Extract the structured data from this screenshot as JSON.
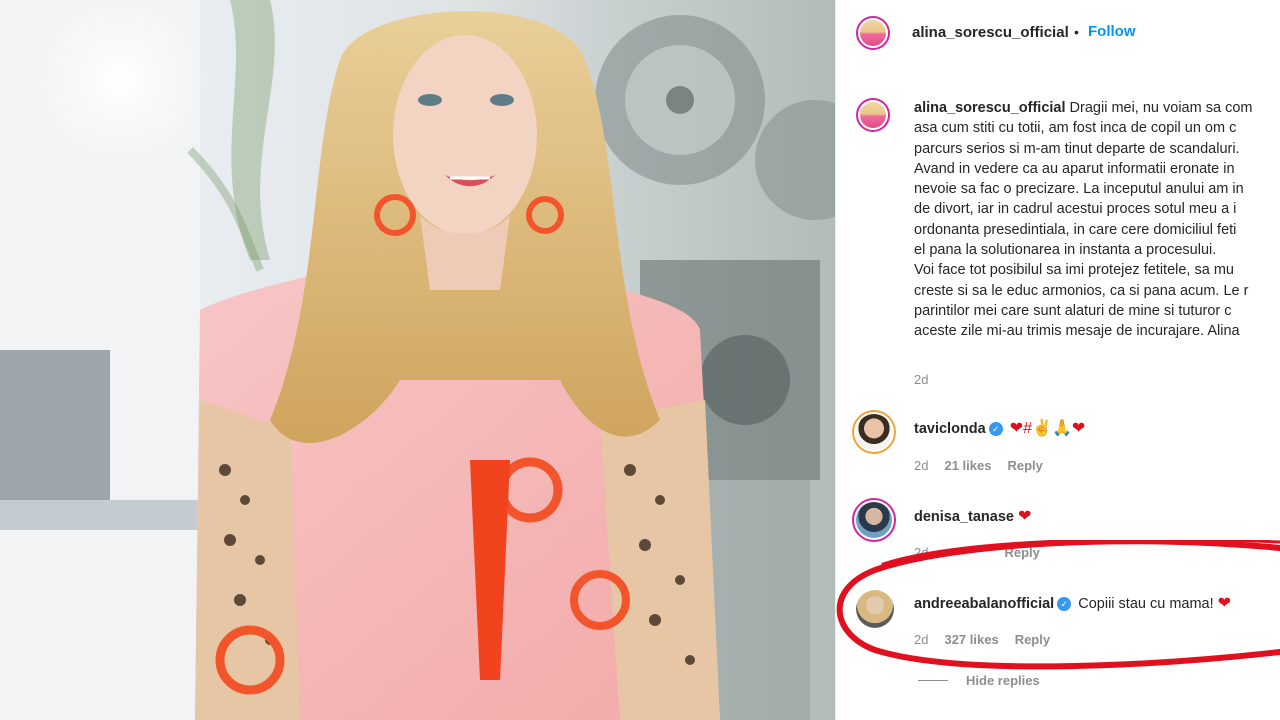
{
  "post": {
    "username": "alina_sorescu_official",
    "separator": "•",
    "follow_label": "Follow",
    "caption_lines": [
      "Dragii mei, nu voiam sa com",
      "asa cum stiti cu totii, am fost inca de copil un om c",
      "parcurs serios si m-am tinut departe de scandaluri.",
      "Avand in vedere ca au aparut informatii eronate in",
      "nevoie sa fac o precizare. La inceputul anului am in",
      "de divort, iar in cadrul acestui proces sotul meu a i",
      "ordonanta presedintiala, in care cere domiciliul feti",
      "el pana la solutionarea in instanta a procesului.",
      "Voi face tot posibilul sa imi protejez fetitele, sa mu",
      "creste si sa le educ armonios, ca si pana acum. Le r",
      "parintilor mei care sunt alaturi de mine si tuturor c",
      "aceste zile mi-au trimis mesaje de incurajare. Alina"
    ],
    "caption_time": "2d"
  },
  "comments": [
    {
      "username": "taviclonda",
      "verified": true,
      "text": "❤#✌🙏❤",
      "time": "2d",
      "likes": "21 likes",
      "reply": "Reply"
    },
    {
      "username": "denisa_tanase",
      "verified": false,
      "text": "❤",
      "time": "2d",
      "likes": "",
      "reply": "Reply"
    },
    {
      "username": "andreeabalanofficial",
      "verified": true,
      "text": "Copiii stau cu mama! ❤",
      "time": "2d",
      "likes": "327 likes",
      "reply": "Reply"
    }
  ],
  "hide_replies_label": "Hide replies",
  "colors": {
    "link_blue": "#0095f6",
    "meta_gray": "#8e8e8e",
    "annotation_red": "#e0101f",
    "heart_red": "#e0101f"
  }
}
